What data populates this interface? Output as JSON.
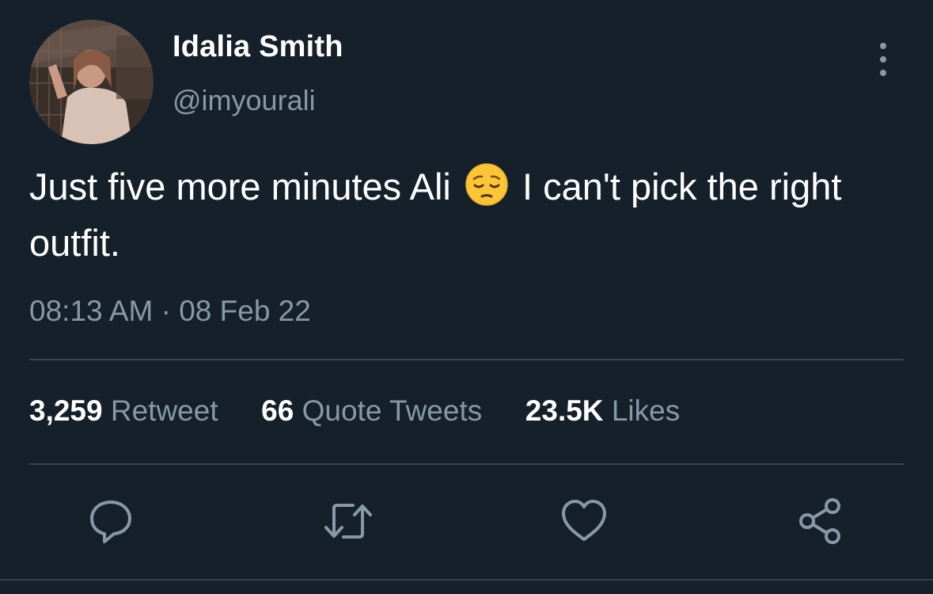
{
  "user": {
    "display_name": "Idalia Smith",
    "handle": "@imyourali",
    "avatar_icon": "profile-photo"
  },
  "tweet": {
    "text_part1": "Just five more minutes Ali",
    "emoji_icon": "pensive-face-emoji",
    "text_part2": "I can't pick the right outfit.",
    "timestamp": "08:13 AM · 08 Feb 22"
  },
  "stats": {
    "retweet_count": "3,259",
    "retweet_label": "Retweet",
    "quote_count": "66",
    "quote_label": "Quote Tweets",
    "likes_count": "23.5K",
    "likes_label": "Likes"
  },
  "actions": {
    "reply_icon": "reply-icon",
    "retweet_icon": "retweet-icon",
    "like_icon": "heart-icon",
    "share_icon": "share-icon"
  },
  "colors": {
    "background": "#15202b",
    "secondary_text": "#8899a6",
    "divider": "#38444d",
    "icon": "#8899a6"
  }
}
